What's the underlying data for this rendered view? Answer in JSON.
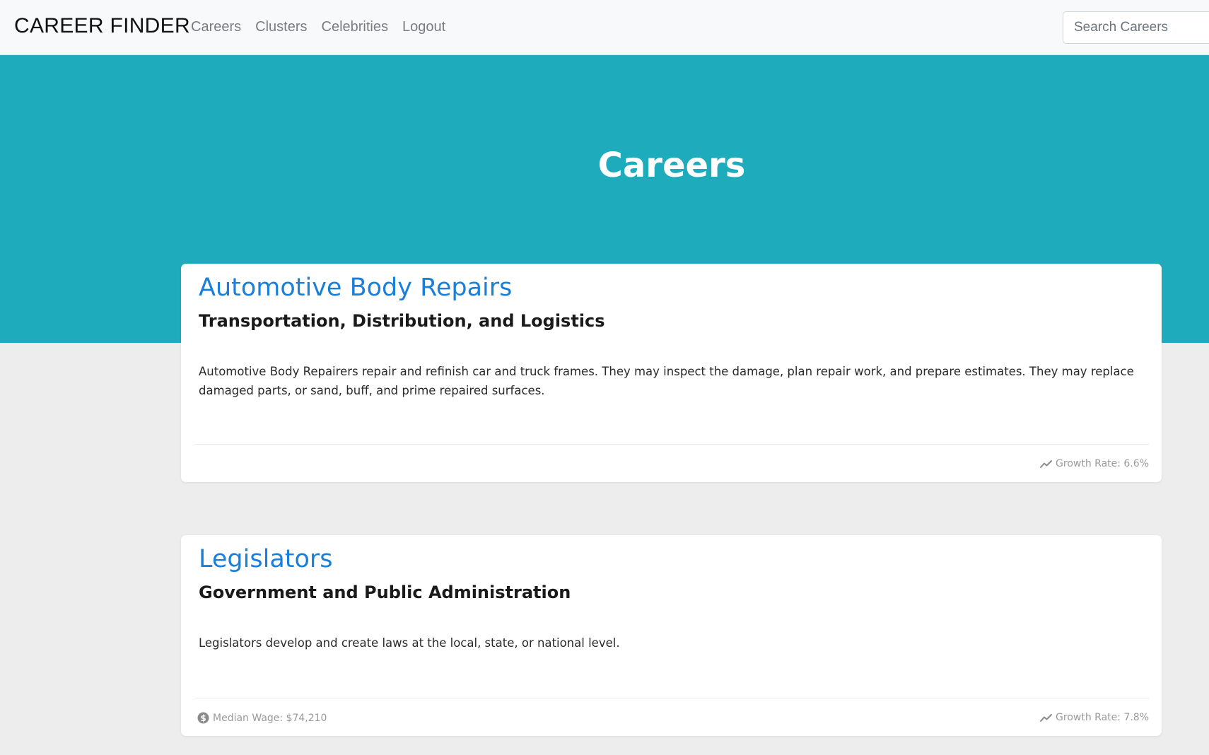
{
  "navbar": {
    "brand": "CAREER FINDER",
    "links": [
      "Careers",
      "Clusters",
      "Celebrities",
      "Logout"
    ],
    "search_placeholder": "Search Careers"
  },
  "hero": {
    "title": "Careers"
  },
  "careers": [
    {
      "title": "Automotive Body Repairs",
      "cluster": "Transportation, Distribution, and Logistics",
      "description": "Automotive Body Repairers repair and refinish car and truck frames. They may inspect the damage, plan repair work, and prepare estimates. They may replace damaged parts, or sand, buff, and prime repaired surfaces.",
      "growth_rate": "Growth Rate: 6.6%"
    },
    {
      "title": "Legislators",
      "cluster": "Government and Public Administration",
      "description": "Legislators develop and create laws at the local, state, or national level.",
      "median_wage": "Median Wage: $74,210",
      "growth_rate": "Growth Rate: 7.8%"
    }
  ],
  "colors": {
    "hero_bg": "#1eabbc",
    "link_blue": "#1a7fd8",
    "page_bg": "#ededed"
  },
  "icons": {
    "growth": "trending-up-icon",
    "wage": "dollar-circle-icon"
  }
}
